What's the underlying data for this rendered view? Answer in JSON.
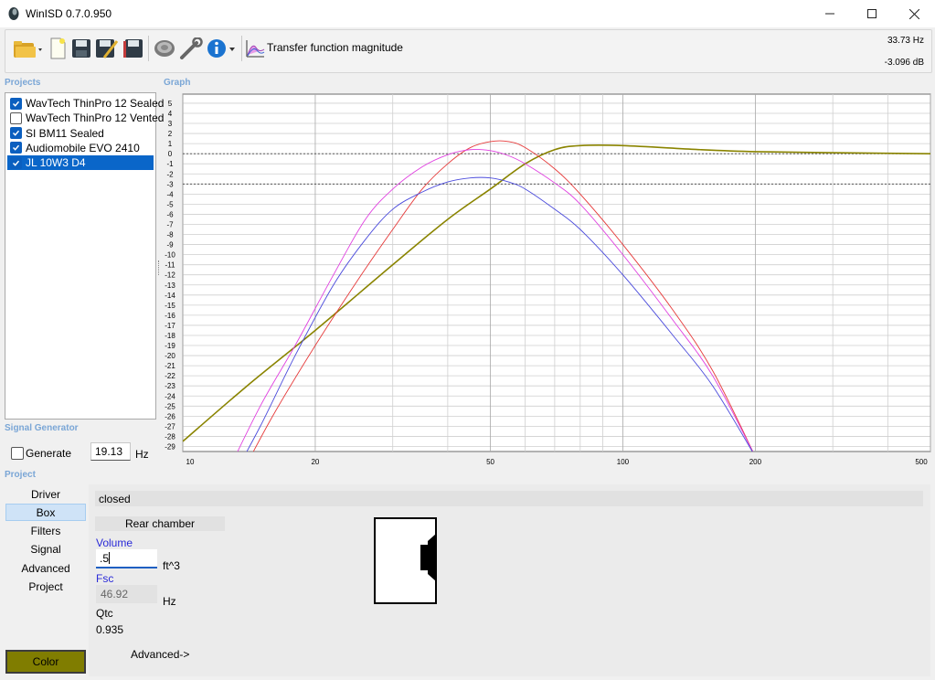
{
  "window": {
    "title": "WinISD 0.7.0.950"
  },
  "toolbar": {
    "transfer_label": "Transfer function magnitude",
    "freq_readout": "33.73 Hz",
    "db_readout": "-3.096 dB",
    "icons": [
      "open-folder-icon",
      "new-file-icon",
      "save-icon",
      "save-as-icon",
      "save-all-icon",
      "driver-icon",
      "wrench-icon",
      "info-icon",
      "graph-icon"
    ]
  },
  "sections": {
    "projects": "Projects",
    "graph": "Graph",
    "signal_generator": "Signal Generator",
    "project": "Project"
  },
  "projects": [
    {
      "name": "WavTech ThinPro 12 Sealed",
      "checked": true,
      "selected": false
    },
    {
      "name": "WavTech ThinPro 12 Vented",
      "checked": false,
      "selected": false
    },
    {
      "name": "SI BM11 Sealed",
      "checked": true,
      "selected": false
    },
    {
      "name": "Audiomobile EVO 2410",
      "checked": true,
      "selected": false
    },
    {
      "name": "JL 10W3 D4",
      "checked": true,
      "selected": true
    }
  ],
  "chart_data": {
    "type": "line",
    "x_scale": "log",
    "xlim": [
      10,
      500
    ],
    "ylim": [
      -29,
      5
    ],
    "x_ticks": [
      "10",
      "20",
      "50",
      "100",
      "200",
      "500"
    ],
    "y_ticks": [
      "5",
      "4",
      "3",
      "2",
      "1",
      "0",
      "-1",
      "-2",
      "-3",
      "-4",
      "-5",
      "-6",
      "-7",
      "-8",
      "-9",
      "-10",
      "-11",
      "-12",
      "-13",
      "-14",
      "-15",
      "-16",
      "-17",
      "-18",
      "-19",
      "-20",
      "-21",
      "-22",
      "-23",
      "-24",
      "-25",
      "-26",
      "-27",
      "-28",
      "-29"
    ],
    "reference_lines": [
      0,
      -3
    ],
    "series": [
      {
        "color": "#8a8400",
        "points": [
          [
            10,
            -28.5
          ],
          [
            14,
            -23
          ],
          [
            20,
            -17.5
          ],
          [
            30,
            -11
          ],
          [
            40,
            -6.5
          ],
          [
            50,
            -3.5
          ],
          [
            60,
            -1
          ],
          [
            70,
            0.4
          ],
          [
            80,
            0.8
          ],
          [
            100,
            0.8
          ],
          [
            150,
            0.4
          ],
          [
            200,
            0.2
          ],
          [
            300,
            0.1
          ],
          [
            500,
            0
          ]
        ]
      },
      {
        "color": "#e63a3a",
        "points": [
          [
            13.5,
            -32
          ],
          [
            16,
            -26
          ],
          [
            20,
            -19
          ],
          [
            25,
            -12.5
          ],
          [
            30,
            -7.5
          ],
          [
            35,
            -3.5
          ],
          [
            40,
            -1
          ],
          [
            45,
            0.6
          ],
          [
            50,
            1.2
          ],
          [
            55,
            1.2
          ],
          [
            60,
            0.6
          ],
          [
            70,
            -1.5
          ],
          [
            80,
            -4
          ],
          [
            100,
            -9
          ],
          [
            130,
            -15.5
          ],
          [
            160,
            -21.5
          ],
          [
            200,
            -30
          ]
        ]
      },
      {
        "color": "#e040e0",
        "points": [
          [
            12.5,
            -32
          ],
          [
            15,
            -25
          ],
          [
            18,
            -19
          ],
          [
            22,
            -12
          ],
          [
            26,
            -6.5
          ],
          [
            30,
            -3.5
          ],
          [
            35,
            -1.3
          ],
          [
            40,
            -0.1
          ],
          [
            45,
            0.4
          ],
          [
            50,
            0.3
          ],
          [
            55,
            -0.2
          ],
          [
            60,
            -1
          ],
          [
            70,
            -2.9
          ],
          [
            80,
            -5
          ],
          [
            100,
            -10
          ],
          [
            130,
            -16.5
          ],
          [
            160,
            -22
          ],
          [
            200,
            -30
          ]
        ]
      },
      {
        "color": "#4a4adc",
        "points": [
          [
            13,
            -32
          ],
          [
            15,
            -27
          ],
          [
            18,
            -20
          ],
          [
            22,
            -13
          ],
          [
            26,
            -8.5
          ],
          [
            30,
            -5.5
          ],
          [
            35,
            -3.8
          ],
          [
            40,
            -2.8
          ],
          [
            45,
            -2.4
          ],
          [
            50,
            -2.4
          ],
          [
            55,
            -2.8
          ],
          [
            60,
            -3.5
          ],
          [
            70,
            -5.5
          ],
          [
            80,
            -7.5
          ],
          [
            100,
            -12
          ],
          [
            130,
            -18
          ],
          [
            160,
            -23
          ],
          [
            200,
            -30
          ]
        ]
      }
    ]
  },
  "signal_generator": {
    "generate_label": "Generate",
    "generate_checked": false,
    "frequency": "19.13",
    "unit": "Hz"
  },
  "nav": [
    "Driver",
    "Box",
    "Filters",
    "Signal",
    "Advanced",
    "Project"
  ],
  "nav_selected": "Box",
  "color_button": {
    "label": "Color",
    "color": "#807d00"
  },
  "box": {
    "type": "closed",
    "rear_chamber": "Rear chamber",
    "volume_label": "Volume",
    "volume_value": ".5",
    "volume_unit": "ft^3",
    "fsc_label": "Fsc",
    "fsc_value": "46.92",
    "fsc_unit": "Hz",
    "qtc_label": "Qtc",
    "qtc_value": "0.935",
    "advanced_label": "Advanced->"
  }
}
